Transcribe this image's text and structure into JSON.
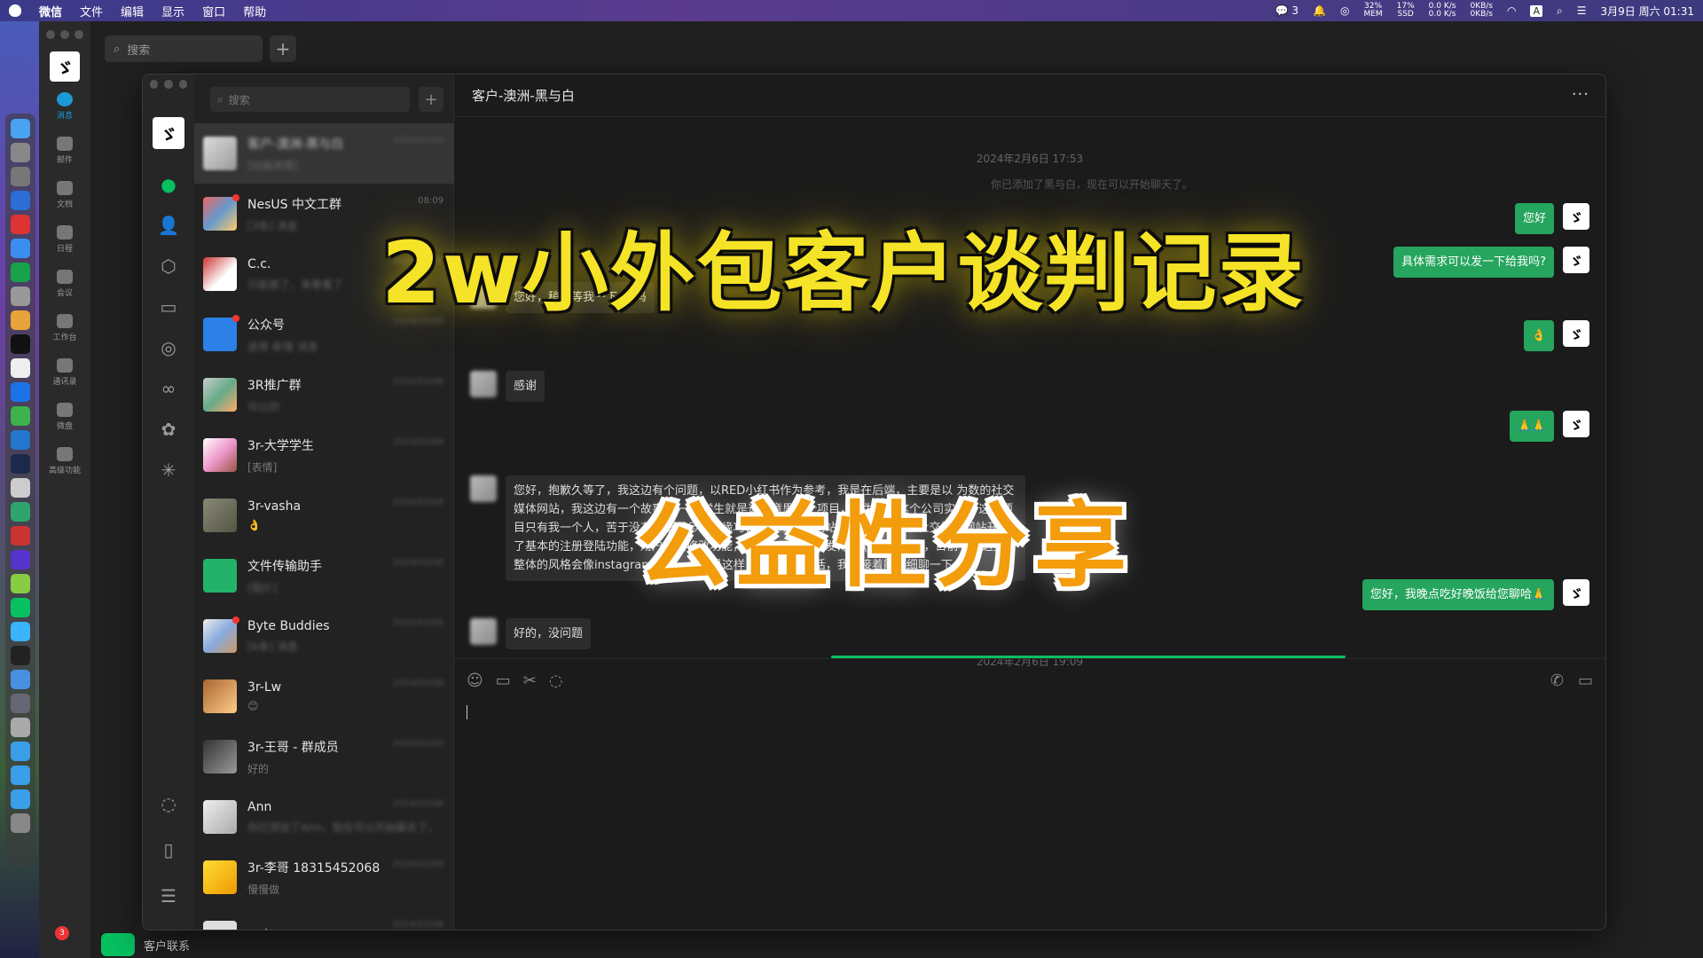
{
  "menubar": {
    "app": "微信",
    "menus": [
      "文件",
      "编辑",
      "显示",
      "窗口",
      "帮助"
    ],
    "notif_count": "3",
    "mem": "32%",
    "mem_label": "MEM",
    "ssd": "17%",
    "ssd_label": "SSD",
    "net_up": "0.0 K/s",
    "net_down": "0.0 K/s",
    "net2_up": "0KB/s",
    "net2_down": "0KB/s",
    "input_method": "A",
    "datetime": "3月9日 周六 01:31"
  },
  "bg_window": {
    "search_placeholder": "搜索",
    "nav": [
      "消息",
      "邮件",
      "文档",
      "日程",
      "会议",
      "工作台",
      "通讯录",
      "微盘",
      "高级功能"
    ],
    "bottom_label": "客户联系",
    "badge": "3"
  },
  "chatlist": {
    "search_placeholder": "搜索",
    "items": [
      {
        "name": "客户-澳洲-黑与白",
        "preview": "[动画表情]",
        "time": "2024/02/20"
      },
      {
        "name": "NesUS 中文工群",
        "preview": "[3条] 消息",
        "time": "08:09"
      },
      {
        "name": "C.c.",
        "preview": "只能做了，来看看了",
        "time": "2024/03/08"
      },
      {
        "name": "公众号",
        "preview": "迪哥 新增 消息",
        "time": "2024/03/08"
      },
      {
        "name": "3R推广群",
        "preview": "可以的",
        "time": "2024/03/08"
      },
      {
        "name": "3r-大学学生",
        "preview": "[表情]",
        "time": "2024/03/08"
      },
      {
        "name": "3r-vasha",
        "preview": "👌",
        "time": "2024/03/08"
      },
      {
        "name": "文件传输助手",
        "preview": "[图片]",
        "time": "2024/03/08"
      },
      {
        "name": "Byte Buddies",
        "preview": "[6条] 消息",
        "time": "2024/03/08"
      },
      {
        "name": "3r-Lw",
        "preview": "😊",
        "time": "2024/03/08"
      },
      {
        "name": "3r-王哥 - 群成员",
        "preview": "好的",
        "time": "2024/02/20"
      },
      {
        "name": "Ann",
        "preview": "你已添加了Ann，现在可以开始聊天了。",
        "time": "2024/03/08"
      },
      {
        "name": "3r-李哥 18315452068",
        "preview": "慢慢做",
        "time": "2024/03/08"
      },
      {
        "name": "云真",
        "preview": "",
        "time": "2024/03/08"
      }
    ]
  },
  "chat": {
    "title": "客户-澳洲-黑与白",
    "more": "···",
    "ts1": "2024年2月6日 17:53",
    "sys1": "你已添加了黑与白，现在可以开始聊天了。",
    "m_out_1": "您好",
    "m_out_2": "具体需求可以发一下给我吗?",
    "m_in_1": "您好，稍微等我一下 ok吗",
    "m_out_3": "👌",
    "m_in_2": "感谢",
    "m_out_4": "🙏🙏",
    "m_in_3": "您好，抱歉久等了，我这边有个问题，以RED小红书作为参考，我是在后端，主要是以 为数的社交媒体网站，我这边有一个故事，一个 学生就是这个意思这个项目，因为我在这个公司实习，这个项目只有我一个人，苦于没有人指导😔，机缘巧合下发现您的网站。我目前在这个社交媒体网站开发了基本的注册登陆功能，用户主页修改功能，现在在开发用户发博客 (post) 功能，目前卡在这里。整体的风格会像instagram那样。大概是这样，如果可以的话，我们接着能详细聊一下",
    "m_out_5": "您好，我晚点吃好晚饭给您聊哈🙏",
    "m_in_4": "好的，没问题",
    "ts2": "2024年2月6日 19:09"
  },
  "overlay": {
    "title": "2w小外包客户谈判记录",
    "subtitle": "公益性分享"
  },
  "colors": {
    "accent": "#07c160",
    "bubble_out": "#25a55d",
    "title_yellow": "#f5e327",
    "subtitle_orange": "#f39c0c"
  }
}
